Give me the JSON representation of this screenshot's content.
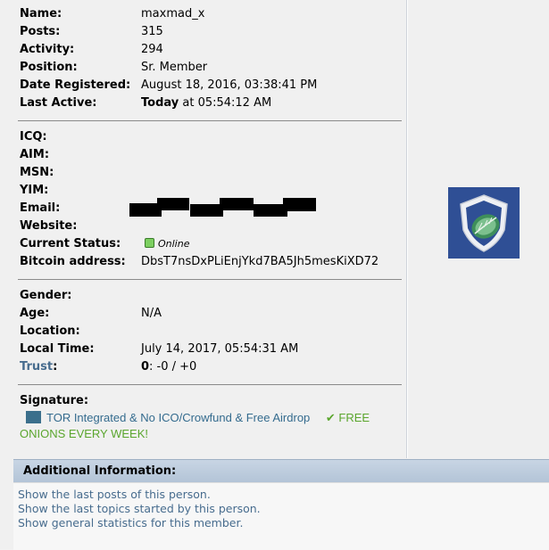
{
  "profile": {
    "name_label": "Name:",
    "name_value": "maxmad_x",
    "posts_label": "Posts:",
    "posts_value": "315",
    "activity_label": "Activity:",
    "activity_value": "294",
    "position_label": "Position:",
    "position_value": "Sr. Member",
    "registered_label": "Date Registered:",
    "registered_value": "August 18, 2016, 03:38:41 PM",
    "active_label": "Last Active:",
    "active_today": "Today",
    "active_time": " at 05:54:12 AM",
    "icq_label": "ICQ:",
    "aim_label": "AIM:",
    "msn_label": "MSN:",
    "yim_label": "YIM:",
    "email_label": "Email:",
    "website_label": "Website:",
    "status_label": "Current Status:",
    "status_value": "Online",
    "bitcoin_label": "Bitcoin address:",
    "bitcoin_value": "DbsT7nsDxPLiEnjYkd7BA5Jh5mesKiXD72",
    "gender_label": "Gender:",
    "age_label": "Age:",
    "age_value": "N/A",
    "location_label": "Location:",
    "localtime_label": "Local Time:",
    "localtime_value": "July 14, 2017, 05:54:31 AM",
    "trust_label": "Trust",
    "trust_colon": ":",
    "trust_score": "0",
    "trust_rest": ": -0 / +0"
  },
  "signature": {
    "label": "Signature:",
    "line1": "TOR Integrated & No ICO/Crowfund & Free Airdrop",
    "check": "✔ FREE",
    "line2": "ONIONS EVERY WEEK!"
  },
  "additional": {
    "title": "Additional Information:",
    "links": [
      "Show the last posts of this person.",
      "Show the last topics started by this person.",
      "Show general statistics for this member."
    ]
  },
  "colors": {
    "link": "#476c8e",
    "sig_green": "#5ba62e",
    "avatar_bg": "#2f4f95"
  },
  "icons": {
    "avatar": "shield-leaf-icon",
    "status": "online-dot-icon"
  }
}
